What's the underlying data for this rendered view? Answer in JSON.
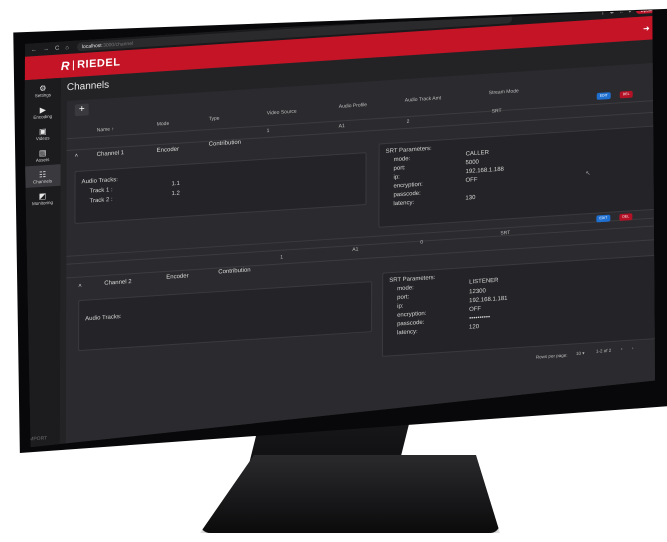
{
  "browser": {
    "url_host": "localhost",
    "url_path": ":3000/channel",
    "update_label": "Update"
  },
  "app": {
    "brand": "RIEDEL",
    "page_title": "Channels"
  },
  "sidebar": {
    "items": [
      {
        "label": "Settings",
        "icon": "settings-icon"
      },
      {
        "label": "Encoding",
        "icon": "encoding-icon"
      },
      {
        "label": "Videos",
        "icon": "videos-icon"
      },
      {
        "label": "Assets",
        "icon": "assets-icon"
      },
      {
        "label": "Channels",
        "icon": "channels-icon"
      },
      {
        "label": "Monitoring",
        "icon": "monitoring-icon"
      }
    ],
    "import_label": "IMPORT",
    "export_label": "EXPORT"
  },
  "toolbar": {
    "add_label": "+"
  },
  "table": {
    "columns": [
      "Name ↑",
      "Mode",
      "Type",
      "Video Source",
      "Audio Profile",
      "Audio Track Amt",
      "Stream Mode"
    ],
    "edit_label": "EDIT",
    "delete_label": "DEL",
    "channels": [
      {
        "name": "Channel 1",
        "mode": "Encoder",
        "type": "Contribution",
        "video_source": "1",
        "audio_profile": "A1",
        "audio_track_amt": "2",
        "stream_mode": "SRT",
        "audio_title": "Audio Tracks:",
        "tracks": [
          {
            "label": "Track 1 :",
            "value": "1.1"
          },
          {
            "label": "Track 2 :",
            "value": "1.2"
          }
        ],
        "srt": {
          "title": "SRT Parameters:",
          "mode_k": "mode:",
          "mode_v": "CALLER",
          "port_k": "port:",
          "port_v": "5000",
          "ip_k": "ip:",
          "ip_v": "192.168.1.188",
          "enc_k": "encryption:",
          "enc_v": "OFF",
          "pass_k": "passcode:",
          "pass_v": "",
          "lat_k": "latency:",
          "lat_v": "130"
        }
      },
      {
        "name": "Channel 2",
        "mode": "Encoder",
        "type": "Contribution",
        "video_source": "1",
        "audio_profile": "A1",
        "audio_track_amt": "0",
        "stream_mode": "SRT",
        "audio_title": "Audio Tracks:",
        "tracks": [],
        "srt": {
          "title": "SRT Parameters:",
          "mode_k": "mode:",
          "mode_v": "LISTENER",
          "port_k": "port:",
          "port_v": "12300",
          "ip_k": "ip:",
          "ip_v": "192.168.1.181",
          "enc_k": "encryption:",
          "enc_v": "OFF",
          "pass_k": "passcode:",
          "pass_v": "••••••••••",
          "lat_k": "latency:",
          "lat_v": "120"
        }
      }
    ]
  },
  "pagination": {
    "rows_label": "Rows per page:",
    "rows_value": "10 ▾",
    "range": "1-2 of 2"
  }
}
